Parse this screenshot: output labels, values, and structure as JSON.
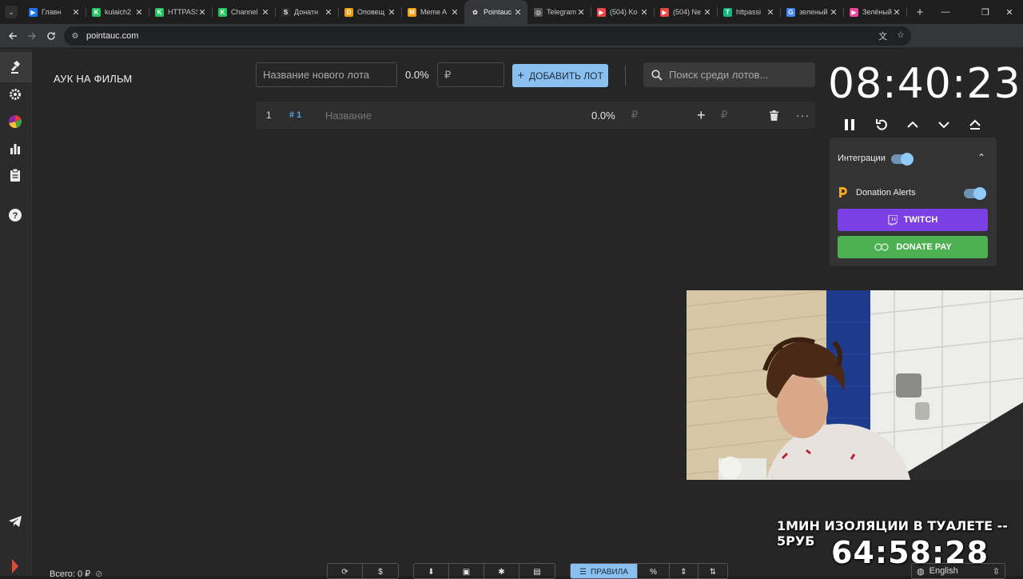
{
  "browser": {
    "tabs": [
      {
        "title": "Главн",
        "favicon_color": "#1a73e8",
        "favicon_glyph": "▶"
      },
      {
        "title": "kulaich2",
        "favicon_color": "#22c55e",
        "favicon_glyph": "K"
      },
      {
        "title": "HTTPASS",
        "favicon_color": "#22c55e",
        "favicon_glyph": "K"
      },
      {
        "title": "Channel",
        "favicon_color": "#22c55e",
        "favicon_glyph": "K"
      },
      {
        "title": "Донатн",
        "favicon_color": "#2b2b2b",
        "favicon_glyph": "S"
      },
      {
        "title": "Оповещ",
        "favicon_color": "#f59e0b",
        "favicon_glyph": "D"
      },
      {
        "title": "Meme A",
        "favicon_color": "#f59e0b",
        "favicon_glyph": "M"
      },
      {
        "title": "Pointauc",
        "favicon_color": "#35363a",
        "favicon_glyph": "✿"
      },
      {
        "title": "Telegram",
        "favicon_color": "#555555",
        "favicon_glyph": "◎"
      },
      {
        "title": "(504) Ko",
        "favicon_color": "#ef4444",
        "favicon_glyph": "▶"
      },
      {
        "title": "(504) Ne",
        "favicon_color": "#ef4444",
        "favicon_glyph": "▶"
      },
      {
        "title": "httpassi",
        "favicon_color": "#10b981",
        "favicon_glyph": "T"
      },
      {
        "title": "зеленый",
        "favicon_color": "#4285f4",
        "favicon_glyph": "G"
      },
      {
        "title": "Зелёный",
        "favicon_color": "#ec4899",
        "favicon_glyph": "▶"
      }
    ],
    "url": "pointauc.com"
  },
  "page": {
    "title": "АУК НА ФИЛЬМ",
    "new_lot_placeholder": "Название нового лота",
    "new_lot_percent": "0.0%",
    "currency_placeholder": "₽",
    "add_lot_label": "ДОБАВИТЬ ЛОТ",
    "search_placeholder": "Поиск среди лотов...",
    "lot": {
      "index": "1",
      "tag": "# 1",
      "name_placeholder": "Название",
      "percent": "0.0%",
      "amount_placeholder": "₽",
      "add_amount_placeholder": "₽"
    }
  },
  "timer": {
    "value": "08:40:23"
  },
  "integrations": {
    "title": "Интеграции",
    "donation_alerts_label": "Donation Alerts",
    "twitch_label": "TWITCH",
    "twitch_color": "#7b3fe4",
    "donatepay_label": "DONATE PAY",
    "donatepay_color": "#4caf50"
  },
  "overlay": {
    "promo_text": "1МИН ИЗОЛЯЦИИ В ТУАЛЕТЕ -- 5РУБ",
    "countdown": "64:58:28"
  },
  "footer": {
    "total_label": "Всего: 0 ₽",
    "rules_label": "ПРАВИЛА",
    "language": "English"
  }
}
